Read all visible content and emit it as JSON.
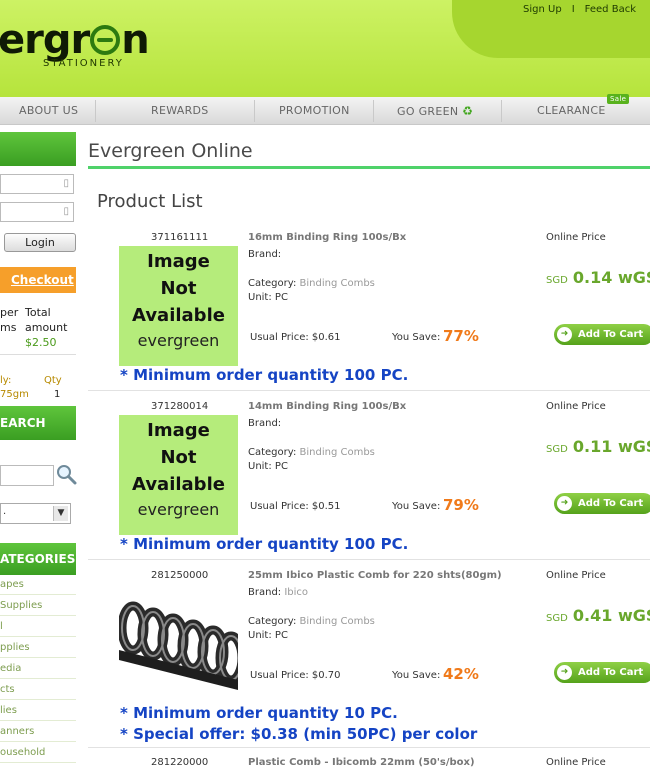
{
  "header": {
    "logo_text_left": "er",
    "logo_text_g": "gr",
    "logo_text_right": "n",
    "logo_sub": "STATIONERY",
    "sign_up": "Sign Up",
    "separator": "I",
    "feedback": "Feed Back"
  },
  "menu": {
    "items": [
      "ABOUT US",
      "REWARDS",
      "PROMOTION",
      "GO GREEN",
      "CLEARANCE"
    ],
    "sale_badge": "Sale"
  },
  "sidebar": {
    "login_label": "Login",
    "checkout_label": "Checkout",
    "cart_col1": "per",
    "cart_col1b": "ms",
    "cart_col2": "Total",
    "cart_col2b": "amount",
    "cart_total": "$2.50",
    "cart_item_label": "ly:",
    "cart_item_sub": "75gm",
    "cart_qty_label": "Qty",
    "cart_qty_value": "1",
    "search_header": "EARCH",
    "categories_header": "ATEGORIES",
    "categories": [
      "apes",
      "Supplies",
      "l",
      "pplies",
      "edia",
      "cts",
      "lies",
      "anners",
      "ousehold"
    ]
  },
  "main": {
    "title": "Evergreen Online",
    "subtitle": "Product List",
    "image_na_lines": [
      "Image",
      "Not",
      "Available"
    ],
    "image_na_brand": "evergreen"
  },
  "labels": {
    "brand": "Brand:",
    "category": "Category:",
    "unit": "Unit:",
    "usual_price": "Usual Price:",
    "you_save": "You Save:",
    "online_price": "Online Price",
    "add_to_cart": "Add To Cart",
    "currency": "SGD"
  },
  "products": [
    {
      "code": "371161111",
      "name": "16mm Binding Ring 100s/Bx",
      "brand": "",
      "category": "Binding Combs",
      "unit": "PC",
      "usual_price": "$0.61",
      "save": "77%",
      "price": "0.14 wGS",
      "min_order": "* Minimum order quantity 100 PC."
    },
    {
      "code": "371280014",
      "name": "14mm Binding Ring 100s/Bx",
      "brand": "",
      "category": "Binding Combs",
      "unit": "PC",
      "usual_price": "$0.51",
      "save": "79%",
      "price": "0.11 wGS",
      "min_order": "* Minimum order quantity 100 PC."
    },
    {
      "code": "281250000",
      "name": "25mm Ibico Plastic Comb for 220 shts(80gm)",
      "brand": "Ibico",
      "category": "Binding Combs",
      "unit": "PC",
      "usual_price": "$0.70",
      "save": "42%",
      "price": "0.41 wGS",
      "min_order": "* Minimum order quantity 10 PC.",
      "special": "* Special offer: $0.38 (min 50PC) per color"
    },
    {
      "code": "281220000",
      "name": "Plastic Comb - Ibicomb 22mm (50's/box)",
      "online_price": "Online Price"
    }
  ]
}
